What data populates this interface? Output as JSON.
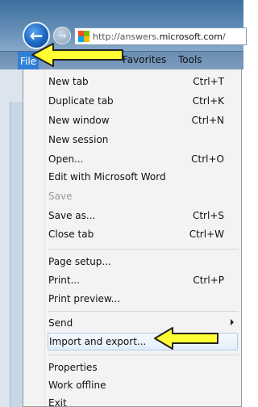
{
  "browser": {
    "url_prefix": "http://answers.",
    "url_domain": "microsoft.com",
    "url_suffix": "/"
  },
  "menubar": {
    "file": "File",
    "favorites": "Favorites",
    "tools": "Tools"
  },
  "file_menu": {
    "items": [
      {
        "label": "New tab",
        "shortcut": "Ctrl+T"
      },
      {
        "label": "Duplicate tab",
        "shortcut": "Ctrl+K"
      },
      {
        "label": "New window",
        "shortcut": "Ctrl+N"
      },
      {
        "label": "New session",
        "shortcut": ""
      },
      {
        "label": "Open...",
        "shortcut": "Ctrl+O"
      },
      {
        "label": "Edit with Microsoft Word",
        "shortcut": ""
      },
      {
        "label": "Save",
        "shortcut": ""
      },
      {
        "label": "Save as...",
        "shortcut": "Ctrl+S"
      },
      {
        "label": "Close tab",
        "shortcut": "Ctrl+W"
      },
      {
        "label": "Page setup...",
        "shortcut": ""
      },
      {
        "label": "Print...",
        "shortcut": "Ctrl+P"
      },
      {
        "label": "Print preview...",
        "shortcut": ""
      },
      {
        "label": "Send",
        "shortcut": ""
      },
      {
        "label": "Import and export...",
        "shortcut": ""
      },
      {
        "label": "Properties",
        "shortcut": ""
      },
      {
        "label": "Work offline",
        "shortcut": ""
      },
      {
        "label": "Exit",
        "shortcut": ""
      }
    ]
  },
  "colors": {
    "menu_highlight": "#2f7fd6",
    "callout_fill": "#ffff33",
    "callout_outline": "#222222"
  },
  "icons": [
    "back-arrow-icon",
    "forward-arrow-icon",
    "microsoft-favicon",
    "submenu-arrow-icon",
    "yellow-pointer-arrow"
  ]
}
